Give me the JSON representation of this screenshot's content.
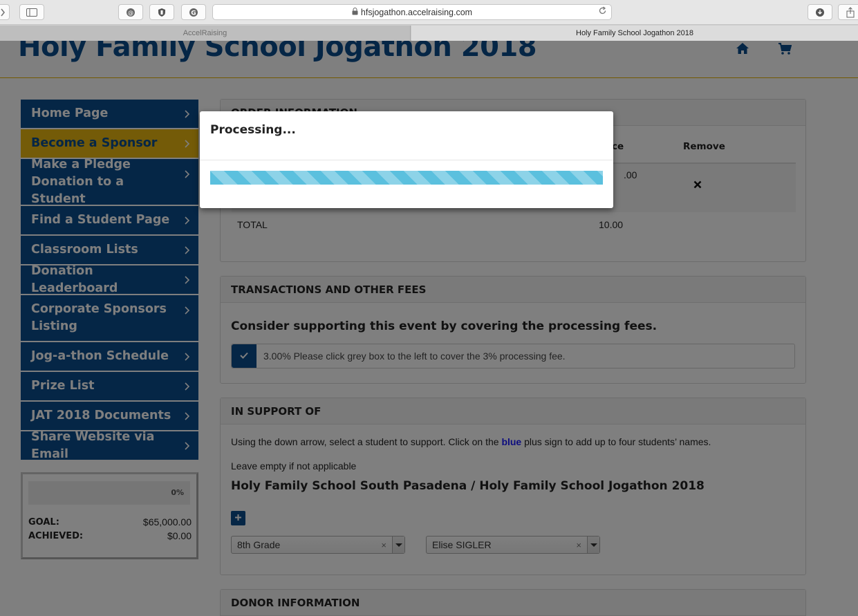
{
  "browser": {
    "url": "hfsjogathon.accelraising.com",
    "tabs": [
      {
        "label": "AccelRaising",
        "active": false
      },
      {
        "label": "Holy Family School Jogathon 2018",
        "active": true
      }
    ]
  },
  "site": {
    "title": "Holy Family School Jogathon 2018",
    "header_icons": [
      "home-icon",
      "cart-icon"
    ],
    "brand_color": "#0b4c8c",
    "accent_color": "#e8b710"
  },
  "sidebar": {
    "items": [
      {
        "label": "Home Page",
        "active": false
      },
      {
        "label": "Become a Sponsor",
        "active": true
      },
      {
        "label": "Make a Pledge Donation to a Student",
        "active": false
      },
      {
        "label": "Find a Student Page",
        "active": false
      },
      {
        "label": "Classroom Lists",
        "active": false
      },
      {
        "label": "Donation Leaderboard",
        "active": false
      },
      {
        "label": "Corporate Sponsors Listing",
        "active": false
      },
      {
        "label": "Jog-a-thon Schedule",
        "active": false
      },
      {
        "label": "Prize List",
        "active": false
      },
      {
        "label": "JAT 2018 Documents",
        "active": false
      },
      {
        "label": "Share Website via Email",
        "active": false
      }
    ],
    "progress": {
      "percent_label": "0%",
      "percent": 0,
      "goal_label": "GOAL:",
      "goal_value": "$65,000.00",
      "achieved_label": "ACHIEVED:",
      "achieved_value": "$0.00"
    }
  },
  "order": {
    "heading": "ORDER INFORMATION",
    "columns": [
      "ce",
      "Remove"
    ],
    "row_price_fragment": ".00",
    "total_label": "TOTAL",
    "total_value": "10.00"
  },
  "fees": {
    "heading": "TRANSACTIONS AND OTHER FEES",
    "question": "Consider supporting this event by covering the processing fees.",
    "checkbox_text": "3.00% Please click grey box to the left to cover the 3% processing fee.",
    "checked": true
  },
  "support": {
    "heading": "IN SUPPORT OF",
    "line1_pre": "Using the down arrow, select a student to support. Click on the",
    "line1_blue": "blue",
    "line1_post": "plus sign to add up to four students’ names.",
    "line2": "Leave empty if not applicable",
    "subheading": "Holy Family School South Pasadena / Holy Family School Jogathon 2018",
    "grade_value": "8th Grade",
    "student_value": "Elise SIGLER"
  },
  "donor": {
    "heading": "DONOR INFORMATION"
  },
  "modal": {
    "title": "Processing...",
    "progress_percent": 100
  }
}
